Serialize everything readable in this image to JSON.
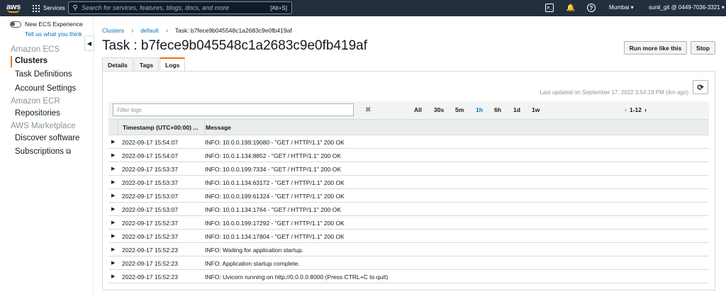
{
  "topnav": {
    "logo_text": "aws",
    "services_label": "Services",
    "search_placeholder": "Search for services, features, blogs, docs, and more",
    "search_shortcut": "[Alt+S]",
    "region": "Mumbai ▾",
    "account": "sunil_git @ 0449-7036-3321 ▾"
  },
  "sidebar": {
    "toggle_label": "New ECS Experience",
    "tell_us": "Tell us what you think",
    "sections": [
      "Amazon ECS",
      "Amazon ECR",
      "AWS Marketplace"
    ],
    "items": [
      "Clusters",
      "Task Definitions",
      "Account Settings",
      "Repositories",
      "Discover software",
      "Subscriptions"
    ],
    "collapse_glyph": "◀"
  },
  "breadcrumb": {
    "clusters": "Clusters",
    "default": "default",
    "current": "Task: b7fece9b045548c1a2683c9e0fb419af"
  },
  "page": {
    "title": "Task : b7fece9b045548c1a2683c9e0fb419af",
    "run_more_label": "Run more like this",
    "stop_label": "Stop"
  },
  "tabs": [
    "Details",
    "Tags",
    "Logs"
  ],
  "active_tab": "Logs",
  "logs": {
    "last_updated": "Last updated on September 17, 2022 3:54:19 PM (4m ago)",
    "filter_placeholder": "Filter logs",
    "ranges": [
      "All",
      "30s",
      "5m",
      "1h",
      "6h",
      "1d",
      "1w"
    ],
    "selected_range": "1h",
    "pagination": "1-12",
    "columns": {
      "timestamp": "Timestamp (UTC+00:00) ...",
      "message": "Message"
    },
    "rows": [
      {
        "ts": "2022-09-17 15:54:07",
        "msg": "INFO: 10.0.0.199:19080 - \"GET / HTTP/1.1\" 200 OK"
      },
      {
        "ts": "2022-09-17 15:54:07",
        "msg": "INFO: 10.0.1.134:8852 - \"GET / HTTP/1.1\" 200 OK"
      },
      {
        "ts": "2022-09-17 15:53:37",
        "msg": "INFO: 10.0.0.199:7334 - \"GET / HTTP/1.1\" 200 OK"
      },
      {
        "ts": "2022-09-17 15:53:37",
        "msg": "INFO: 10.0.1.134:63172 - \"GET / HTTP/1.1\" 200 OK"
      },
      {
        "ts": "2022-09-17 15:53:07",
        "msg": "INFO: 10.0.0.199:61324 - \"GET / HTTP/1.1\" 200 OK"
      },
      {
        "ts": "2022-09-17 15:53:07",
        "msg": "INFO: 10.0.1.134:1764 - \"GET / HTTP/1.1\" 200 OK"
      },
      {
        "ts": "2022-09-17 15:52:37",
        "msg": "INFO: 10.0.0.199:17292 - \"GET / HTTP/1.1\" 200 OK"
      },
      {
        "ts": "2022-09-17 15:52:37",
        "msg": "INFO: 10.0.1.134:17804 - \"GET / HTTP/1.1\" 200 OK"
      },
      {
        "ts": "2022-09-17 15:52:23",
        "msg": "INFO: Waiting for application startup."
      },
      {
        "ts": "2022-09-17 15:52:23",
        "msg": "INFO: Application startup complete."
      },
      {
        "ts": "2022-09-17 15:52:23",
        "msg": "INFO: Uvicorn running on http://0.0.0.0:8000 (Press CTRL+C to quit)"
      }
    ]
  },
  "colors": {
    "nav_bg": "#232f3e",
    "accent_orange": "#ec7211",
    "link_blue": "#0073bb"
  }
}
